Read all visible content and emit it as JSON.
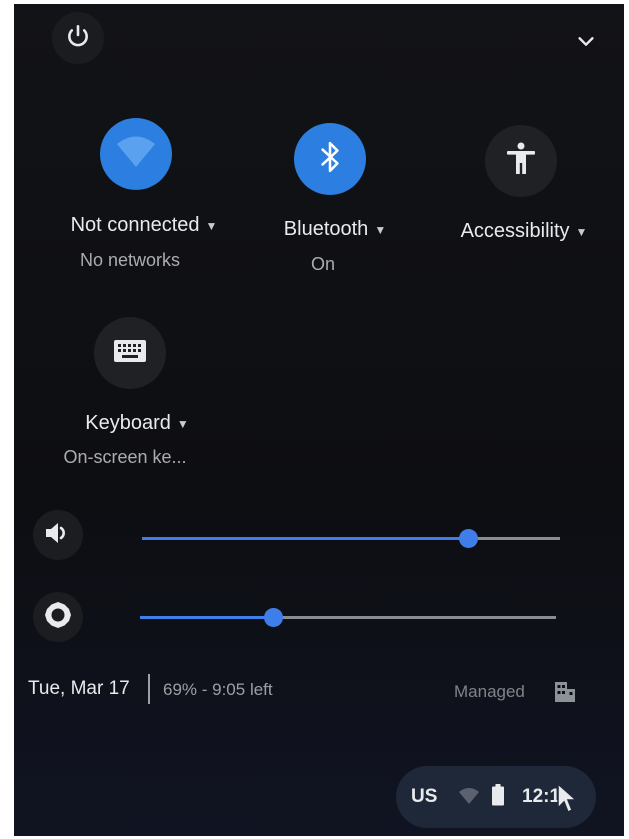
{
  "tiles": {
    "network": {
      "label": "Not connected",
      "sub": "No networks",
      "icon": "wifi-icon"
    },
    "bluetooth": {
      "label": "Bluetooth",
      "sub": "On",
      "icon": "bluetooth-icon"
    },
    "accessibility": {
      "label": "Accessibility",
      "icon": "accessibility-icon"
    },
    "keyboard": {
      "label": "Keyboard",
      "sub": "On-screen ke...",
      "icon": "keyboard-icon"
    }
  },
  "sliders": {
    "volume": {
      "level": 0.78,
      "icon": "volume-icon"
    },
    "brightness": {
      "level": 0.32,
      "icon": "brightness-icon"
    }
  },
  "footer": {
    "date": "Tue, Mar 17",
    "battery": "69% - 9:05 left",
    "managed": "Managed"
  },
  "shelf": {
    "ime": "US",
    "time": "12:1"
  },
  "colors": {
    "accent": "#2c7fe0",
    "panel": "#0f1013",
    "text": "#e8eaed",
    "subtext": "#a9acb1"
  }
}
